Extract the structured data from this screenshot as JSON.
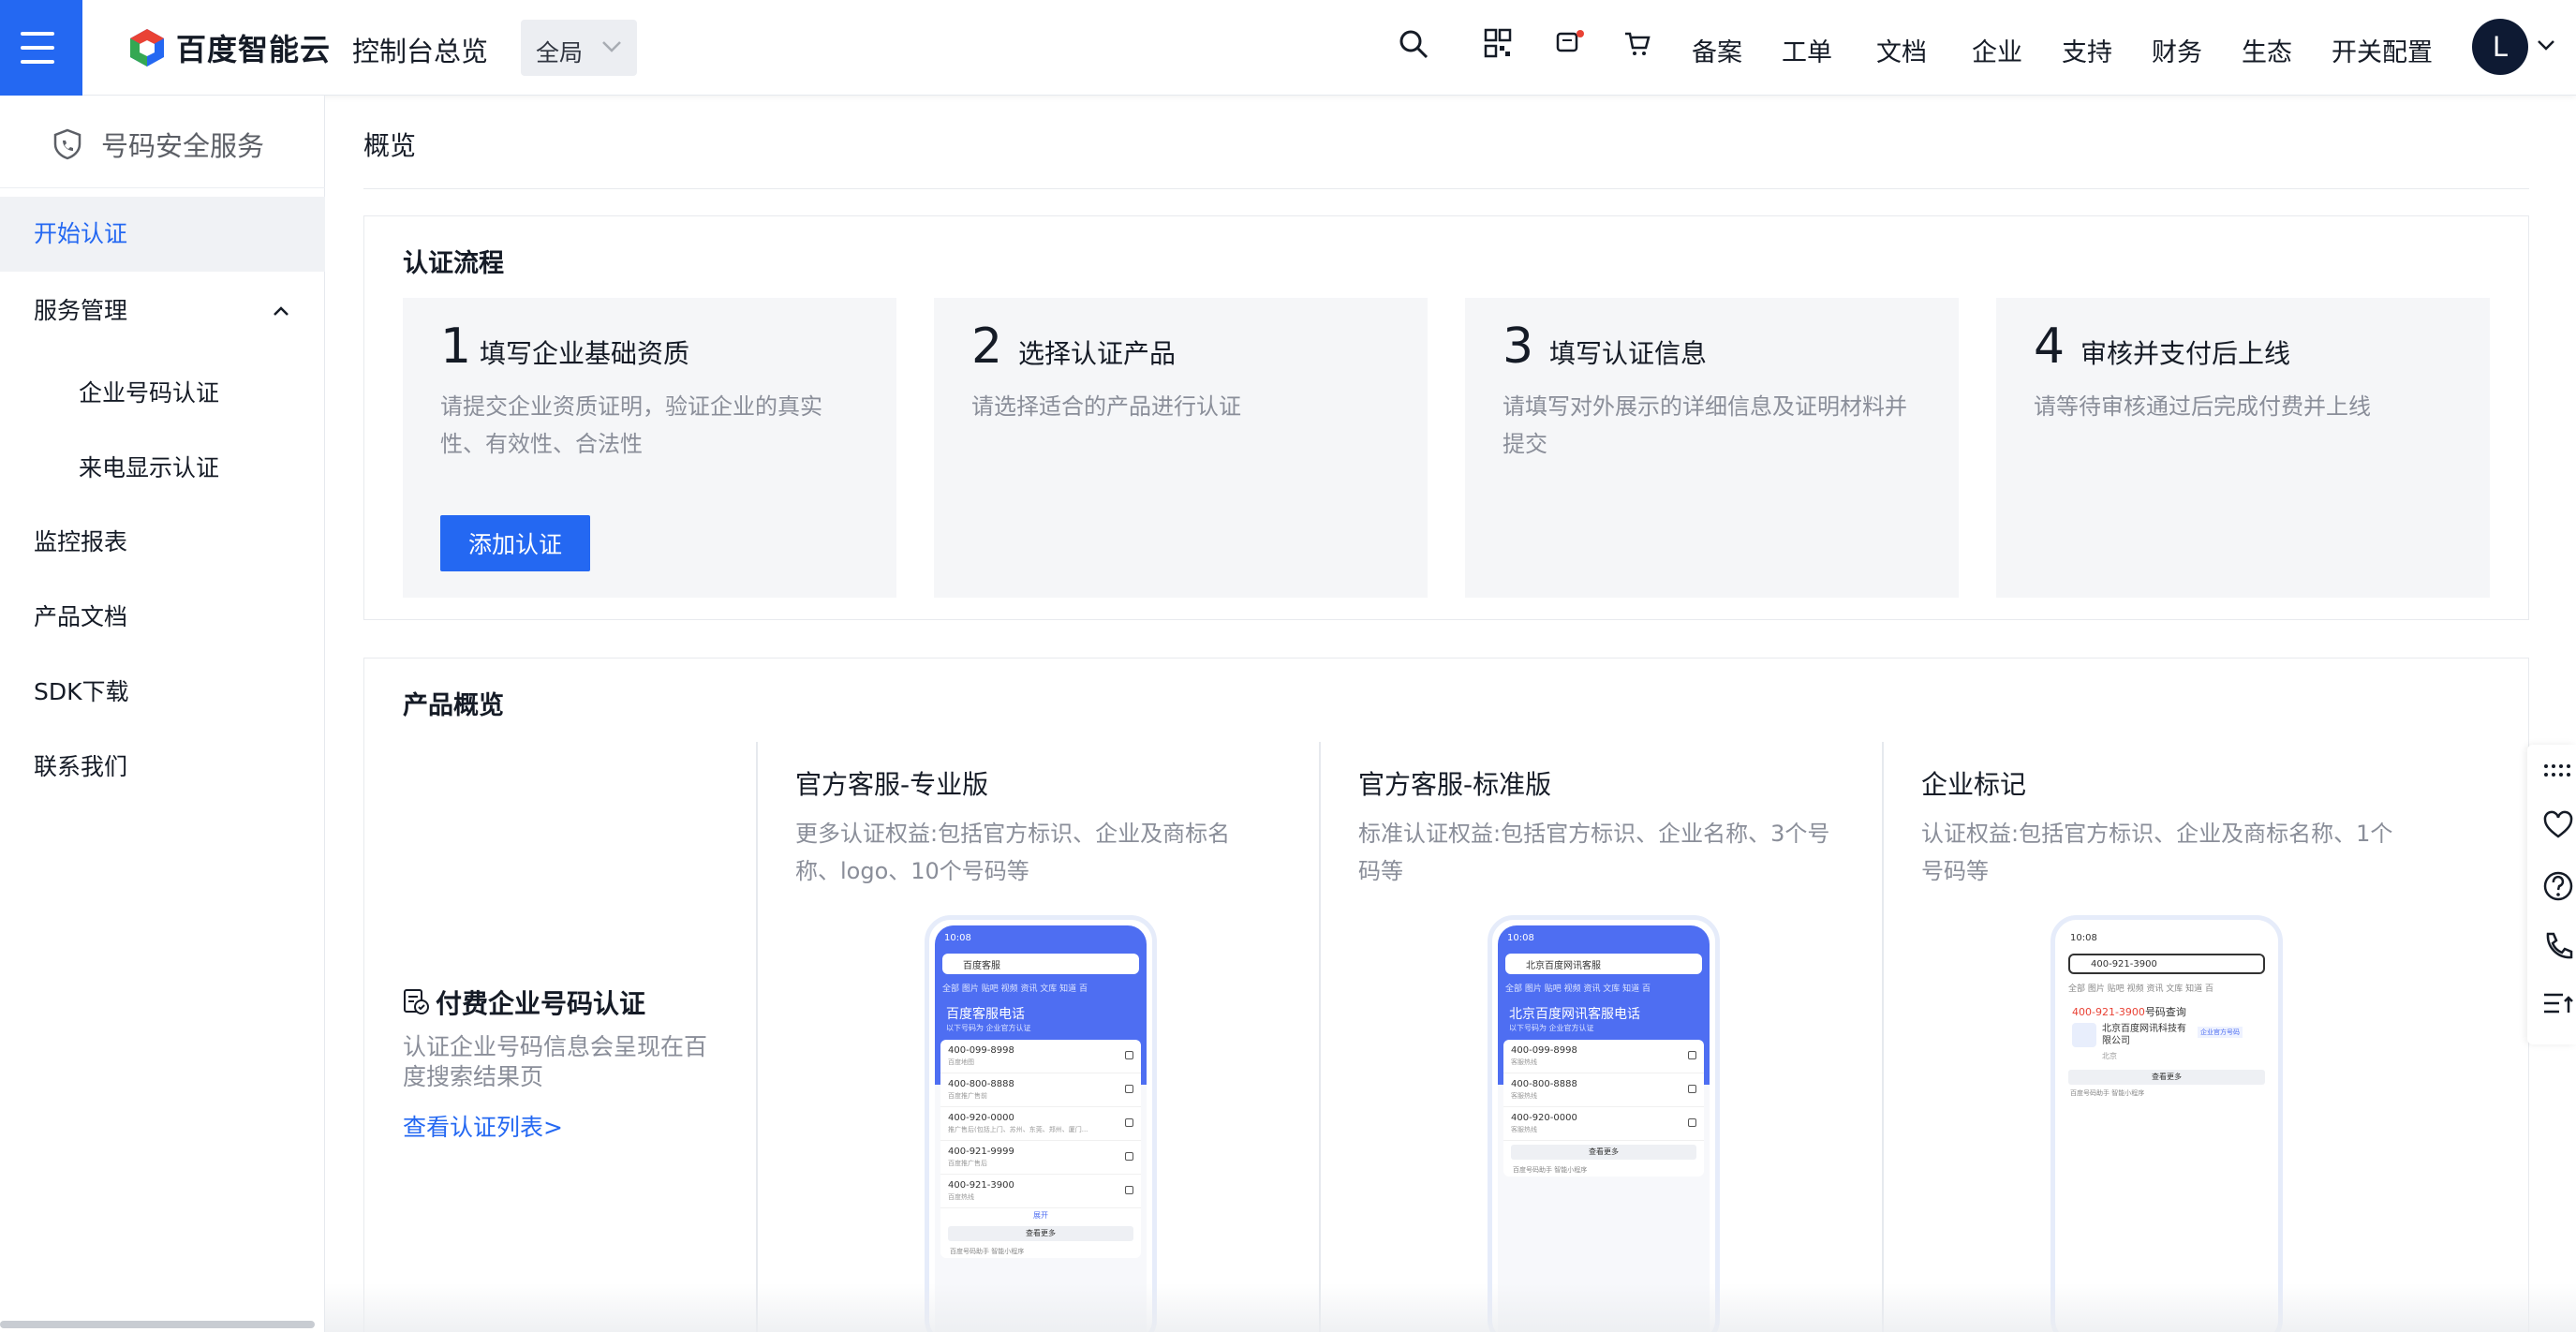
{
  "header": {
    "logo_text": "百度智能云",
    "console_title": "控制台总览",
    "region": "全局",
    "nav": [
      "备案",
      "工单",
      "文档",
      "企业",
      "支持",
      "财务",
      "生态",
      "开关配置"
    ],
    "avatar_letter": "L"
  },
  "sidebar": {
    "title": "号码安全服务",
    "items": [
      {
        "label": "开始认证"
      },
      {
        "label": "服务管理"
      },
      {
        "label": "企业号码认证"
      },
      {
        "label": "来电显示认证"
      },
      {
        "label": "监控报表"
      },
      {
        "label": "产品文档"
      },
      {
        "label": "SDK下载"
      },
      {
        "label": "联系我们"
      }
    ]
  },
  "main": {
    "page_title": "概览",
    "process": {
      "title": "认证流程",
      "steps": [
        {
          "num": "1",
          "name": "填写企业基础资质",
          "desc": "请提交企业资质证明，验证企业的真实性、有效性、合法性"
        },
        {
          "num": "2",
          "name": "选择认证产品",
          "desc": "请选择适合的产品进行认证"
        },
        {
          "num": "3",
          "name": "填写认证信息",
          "desc": "请填写对外展示的详细信息及证明材料并提交"
        },
        {
          "num": "4",
          "name": "审核并支付后上线",
          "desc": "请等待审核通过后完成付费并上线"
        }
      ],
      "add_button": "添加认证"
    },
    "overview": {
      "title": "产品概览",
      "pay_title": "付费企业号码认证",
      "pay_desc": "认证企业号码信息会呈现在百度搜索结果页",
      "pay_link": "查看认证列表>",
      "products": [
        {
          "name": "官方客服-专业版",
          "desc": "更多认证权益:包括官方标识、企业及商标名称、logo、10个号码等",
          "phone": {
            "time": "10:08",
            "query": "百度客服",
            "tabs": "全部  图片  贴吧  视频  资讯  文库  知道  百",
            "card_title": "百度客服电话",
            "card_sub": "以下号码为 企业官方认证",
            "rows": [
              {
                "num": "400-099-8998",
                "sub": "百度地图"
              },
              {
                "num": "400-800-8888",
                "sub": "百度推广售前"
              },
              {
                "num": "400-920-0000",
                "sub": "推广售后(包括上门、苏州、东莞、郑州、厦门..."
              },
              {
                "num": "400-921-9999",
                "sub": "百度推广售后"
              },
              {
                "num": "400-921-3900",
                "sub": "百度热线"
              }
            ],
            "expand": "展开",
            "more": "查看更多",
            "footer": "百度号码助手  智能小程序"
          }
        },
        {
          "name": "官方客服-标准版",
          "desc": "标准认证权益:包括官方标识、企业名称、3个号码等",
          "phone": {
            "time": "10:08",
            "query": "北京百度网讯客服",
            "tabs": "全部  图片  贴吧  视频  资讯  文库  知道  百",
            "card_title": "北京百度网讯客服电话",
            "card_sub": "以下号码为 企业官方认证",
            "rows": [
              {
                "num": "400-099-8998",
                "sub": "客服热线"
              },
              {
                "num": "400-800-8888",
                "sub": "客服热线"
              },
              {
                "num": "400-920-0000",
                "sub": "客服热线"
              }
            ],
            "more": "查看更多",
            "footer": "百度号码助手  智能小程序"
          }
        },
        {
          "name": "企业标记",
          "desc": "认证权益:包括官方标识、企业及商标名称、1个号码等",
          "phone": {
            "time": "10:08",
            "query": "400-921-3900",
            "tabs": "全部  图片  贴吧  视频  资讯  文库  知道  百",
            "result_num": "400-921-3900",
            "result_suffix": "号码查询",
            "company": "北京百度网讯科技有限公司",
            "city": "北京",
            "badge": "企业官方号码",
            "more": "查看更多",
            "footer": "百度号码助手  智能小程序"
          }
        }
      ]
    }
  },
  "colors": {
    "accent": "#2468f2",
    "sidebar_active_bg": "#f0f2f5",
    "step_bg": "#f5f6f8",
    "phone_blue": "#4e6ef2"
  }
}
